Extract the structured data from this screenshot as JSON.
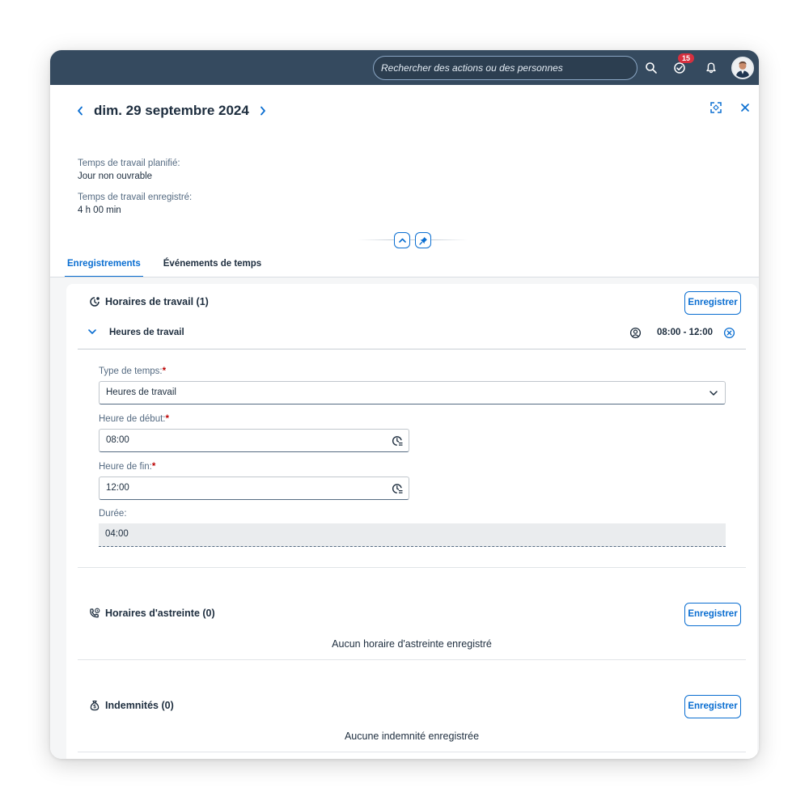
{
  "shell": {
    "search_placeholder": "Rechercher des actions ou des personnes",
    "notification_count": "15",
    "icons": [
      "search-icon",
      "tasks-icon",
      "bell-icon"
    ]
  },
  "header": {
    "date": "dim. 29 septembre 2024",
    "planned_label": "Temps de travail planifié:",
    "planned_value": "Jour non ouvrable",
    "recorded_label": "Temps de travail enregistré:",
    "recorded_value": "4 h 00 min"
  },
  "tabs": [
    {
      "label": "Enregistrements",
      "active": true
    },
    {
      "label": "Événements de temps",
      "active": false
    }
  ],
  "work_hours": {
    "title": "Horaires de travail (1)",
    "save_label": "Enregistrer",
    "entry": {
      "label": "Heures de travail",
      "range": "08:00 - 12:00",
      "time_type_label": "Type de temps:",
      "time_type_value": "Heures de travail",
      "start_label": "Heure de début:",
      "start_value": "08:00",
      "end_label": "Heure de fin:",
      "end_value": "12:00",
      "duration_label": "Durée:",
      "duration_value": "04:00"
    }
  },
  "on_call": {
    "title": "Horaires d'astreinte (0)",
    "save_label": "Enregistrer",
    "empty": "Aucun horaire d'astreinte enregistré"
  },
  "allowances": {
    "title": "Indemnités (0)",
    "save_label": "Enregistrer",
    "empty": "Aucune indemnité enregistrée"
  },
  "colors": {
    "shell": "#354a5f",
    "accent": "#0a6ed1",
    "badge": "#d6303f",
    "required": "#bb0000"
  }
}
